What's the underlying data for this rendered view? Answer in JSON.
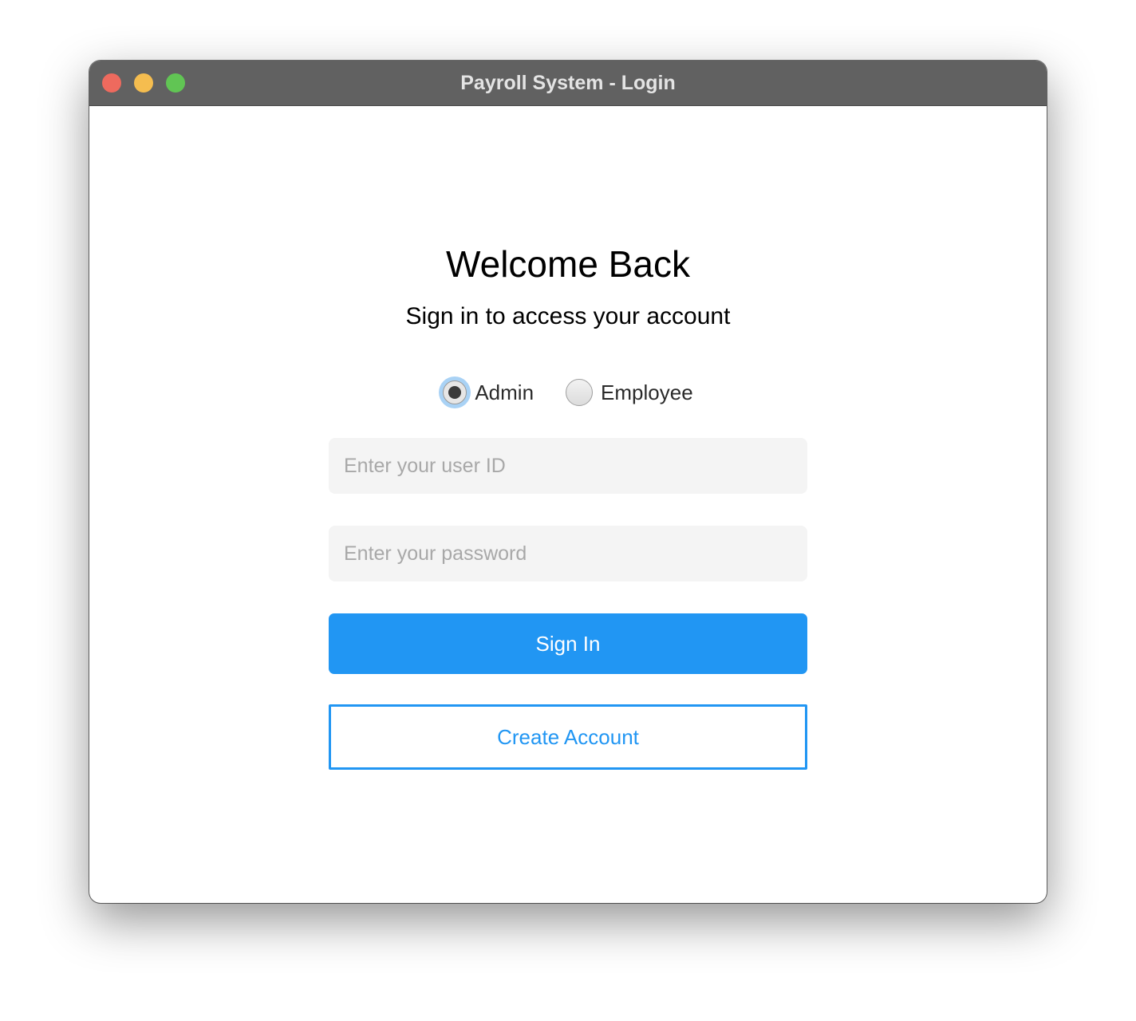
{
  "window": {
    "title": "Payroll System - Login"
  },
  "login": {
    "heading": "Welcome Back",
    "subheading": "Sign in to access your account",
    "roles": [
      {
        "label": "Admin",
        "selected": true
      },
      {
        "label": "Employee",
        "selected": false
      }
    ],
    "user_id_placeholder": "Enter your user ID",
    "password_placeholder": "Enter your password",
    "sign_in_label": "Sign In",
    "create_account_label": "Create Account"
  },
  "colors": {
    "accent": "#2196f3",
    "titlebar": "#616161",
    "field_background": "#f4f4f4",
    "close": "#ee6a5e",
    "minimize": "#f5bd4f",
    "maximize": "#61c554"
  }
}
